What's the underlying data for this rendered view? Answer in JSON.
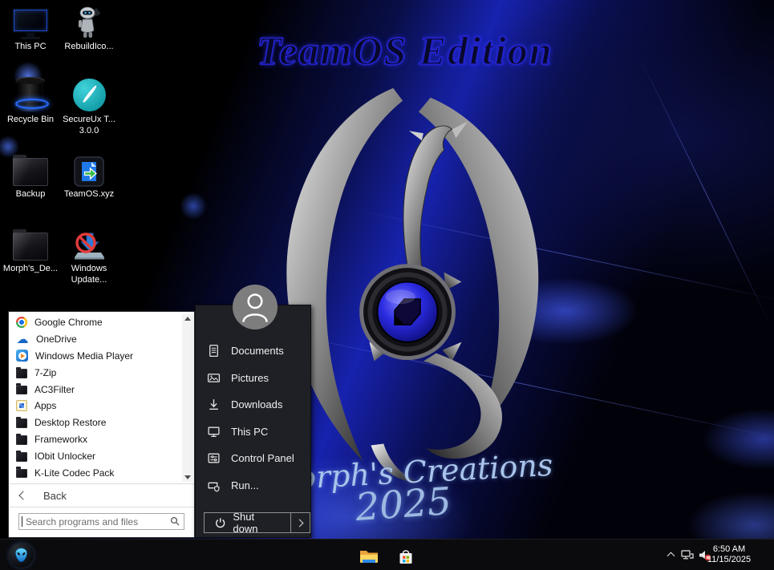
{
  "wallpaper": {
    "edition_title": "TeamOS Edition",
    "signature": "Morph's Creations",
    "signature_year": "2025",
    "accent_color": "#1722ae",
    "emblem_color": "#2a2ae0"
  },
  "desktop_icons": [
    {
      "label": "This PC",
      "icon": "this-pc-monitor-icon"
    },
    {
      "label": "RebuildIco...",
      "icon": "robot-icon"
    },
    {
      "label": "Recycle Bin",
      "icon": "recycle-bin-icon"
    },
    {
      "label": "SecureUx T...",
      "label2": "3.0.0",
      "icon": "secureux-brush-icon"
    },
    {
      "label": "Backup",
      "icon": "dark-folder-icon"
    },
    {
      "label": "TeamOS.xyz",
      "icon": "teamos-file-icon"
    },
    {
      "label": "Morph's_De...",
      "icon": "dark-folder-icon"
    },
    {
      "label": "Windows",
      "label2": "Update...",
      "icon": "windows-update-blocked-icon"
    }
  ],
  "start_menu": {
    "programs": [
      {
        "label": "Google Chrome",
        "icon": "chrome-icon"
      },
      {
        "label": "OneDrive",
        "icon": "onedrive-cloud-icon"
      },
      {
        "label": "Windows Media Player",
        "icon": "media-player-icon"
      },
      {
        "label": "7-Zip",
        "icon": "dark-folder-icon"
      },
      {
        "label": "AC3Filter",
        "icon": "dark-folder-icon"
      },
      {
        "label": "Apps",
        "icon": "apps-grid-icon"
      },
      {
        "label": "Desktop Restore",
        "icon": "dark-folder-icon"
      },
      {
        "label": "Frameworkx",
        "icon": "dark-folder-icon"
      },
      {
        "label": "IObit Unlocker",
        "icon": "dark-folder-icon"
      },
      {
        "label": "K-Lite Codec Pack",
        "icon": "dark-folder-icon"
      }
    ],
    "back_label": "Back",
    "search_placeholder": "Search programs and files",
    "right_items": [
      {
        "label": "Documents",
        "icon": "document-icon"
      },
      {
        "label": "Pictures",
        "icon": "pictures-icon"
      },
      {
        "label": "Downloads",
        "icon": "download-arrow-icon"
      },
      {
        "label": "This PC",
        "icon": "monitor-icon"
      },
      {
        "label": "Control Panel",
        "icon": "control-panel-icon"
      },
      {
        "label": "Run...",
        "icon": "run-window-icon"
      }
    ],
    "shutdown_label": "Shut down"
  },
  "taskbar": {
    "start_button": "alienware-start-orb",
    "pinned": [
      {
        "name": "file-explorer",
        "icon": "folder-icon"
      },
      {
        "name": "microsoft-store",
        "icon": "store-bag-icon"
      }
    ],
    "tray": {
      "icons": [
        "chevron-up-icon",
        "network-icon",
        "volume-muted-icon"
      ],
      "time": "6:50 AM",
      "date": "11/15/2025"
    }
  }
}
